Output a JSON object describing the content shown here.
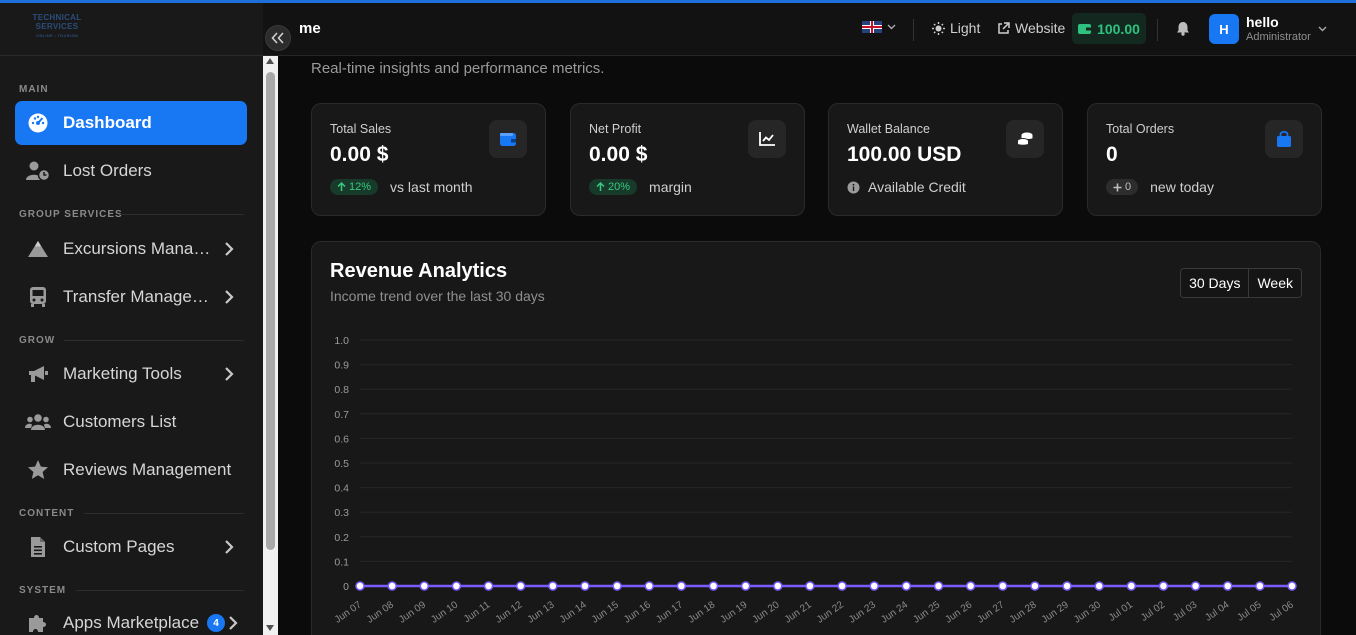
{
  "header": {
    "page_title": "me",
    "theme_label": "Light",
    "website_label": "Website",
    "wallet_amount": "100.00",
    "user_initial": "H",
    "user_name": "hello",
    "user_role": "Administrator"
  },
  "logo": {
    "line1": "TECHNICAL",
    "line2": "SERVICES",
    "line3": "ONLINE • TOURISM"
  },
  "sidebar": {
    "sections": [
      "MAIN",
      "GROUP SERVICES",
      "GROW",
      "CONTENT",
      "SYSTEM"
    ],
    "items": [
      {
        "label": "Dashboard",
        "icon": "dashboard-gauge-icon"
      },
      {
        "label": "Lost Orders",
        "icon": "user-clock-icon"
      },
      {
        "label": "Excursions Management",
        "icon": "mountain-icon"
      },
      {
        "label": "Transfer Management",
        "icon": "bus-icon"
      },
      {
        "label": "Marketing Tools",
        "icon": "megaphone-icon"
      },
      {
        "label": "Customers List",
        "icon": "users-icon"
      },
      {
        "label": "Reviews Management",
        "icon": "star-icon"
      },
      {
        "label": "Custom Pages",
        "icon": "file-icon"
      },
      {
        "label": "Apps Marketplace",
        "icon": "puzzle-icon",
        "badge": "4"
      }
    ]
  },
  "main": {
    "subtitle": "Real-time insights and performance metrics."
  },
  "cards": [
    {
      "title": "Total Sales",
      "value": "0.00 $",
      "pill": "12%",
      "foot": "vs last month",
      "icon": "wallet-icon"
    },
    {
      "title": "Net Profit",
      "value": "0.00 $",
      "pill": "20%",
      "foot": "margin",
      "icon": "chart-line-icon"
    },
    {
      "title": "Wallet Balance",
      "value": "100.00 USD",
      "foot": "Available Credit",
      "icon": "coins-icon"
    },
    {
      "title": "Total Orders",
      "value": "0",
      "pill": "0",
      "foot": "new today",
      "icon": "shopping-bag-icon"
    }
  ],
  "revenue": {
    "title": "Revenue Analytics",
    "subtitle": "Income trend over the last 30 days",
    "range_buttons": [
      "30 Days",
      "Week"
    ]
  },
  "colors": {
    "accent": "#1877f2",
    "positive": "#38c97f",
    "series_line": "#7c5cff"
  },
  "chart_data": {
    "type": "line",
    "title": "Revenue Analytics",
    "categories": [
      "Jun 07",
      "Jun 08",
      "Jun 09",
      "Jun 10",
      "Jun 11",
      "Jun 12",
      "Jun 13",
      "Jun 14",
      "Jun 15",
      "Jun 16",
      "Jun 17",
      "Jun 18",
      "Jun 19",
      "Jun 20",
      "Jun 21",
      "Jun 22",
      "Jun 23",
      "Jun 24",
      "Jun 25",
      "Jun 26",
      "Jun 27",
      "Jun 28",
      "Jun 29",
      "Jun 30",
      "Jul 01",
      "Jul 02",
      "Jul 03",
      "Jul 04",
      "Jul 05",
      "Jul 06"
    ],
    "series": [
      {
        "values": [
          0,
          0,
          0,
          0,
          0,
          0,
          0,
          0,
          0,
          0,
          0,
          0,
          0,
          0,
          0,
          0,
          0,
          0,
          0,
          0,
          0,
          0,
          0,
          0,
          0,
          0,
          0,
          0,
          0,
          0
        ]
      }
    ],
    "yticks": [
      "0",
      "0.1",
      "0.2",
      "0.3",
      "0.4",
      "0.5",
      "0.6",
      "0.7",
      "0.8",
      "0.9",
      "1.0"
    ],
    "ylim": [
      0,
      1
    ],
    "grid": true
  }
}
